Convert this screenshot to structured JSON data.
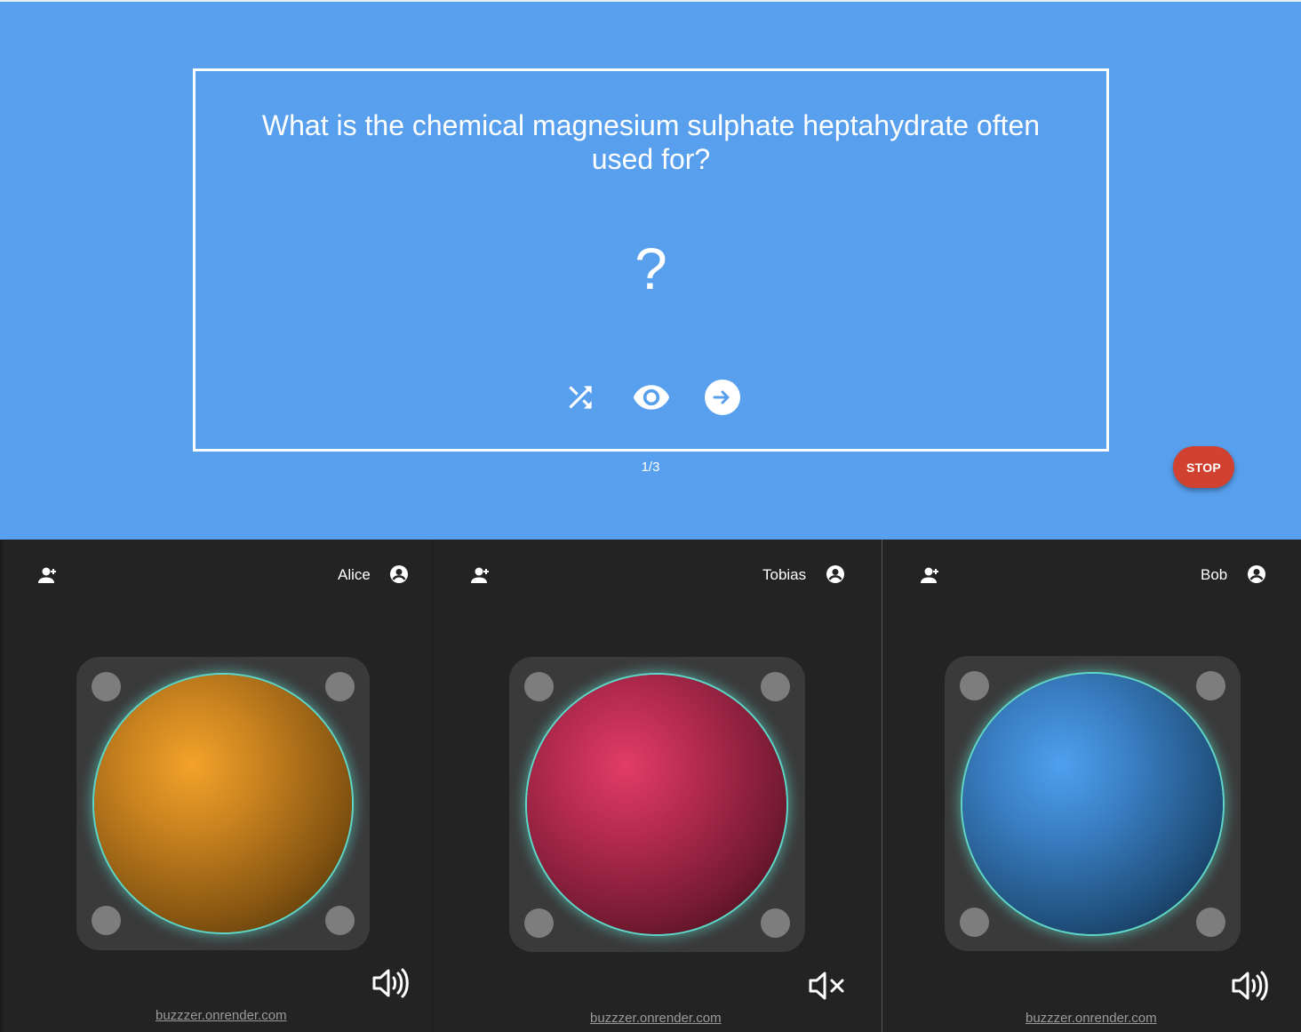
{
  "question": {
    "text": "What is the chemical magnesium sulphate heptahydrate often used for?",
    "answer_placeholder": "?",
    "counter": "1/3"
  },
  "actions": {
    "shuffle_icon": "shuffle-icon",
    "reveal_icon": "eye-icon",
    "next_icon": "arrow-right-circle-icon"
  },
  "stop_label": "STOP",
  "players": [
    {
      "name": "Alice",
      "color": "#e8951f",
      "sound": "on",
      "url": "buzzzer.onrender.com"
    },
    {
      "name": "Tobias",
      "color": "#d63560",
      "sound": "muted",
      "url": "buzzzer.onrender.com"
    },
    {
      "name": "Bob",
      "color": "#4a9cec",
      "sound": "on",
      "url": "buzzzer.onrender.com"
    }
  ],
  "colors": {
    "top_background": "#58a0ee",
    "panel_background": "#232323",
    "stop_button": "#d0412f",
    "glow": "#5fd7c8"
  }
}
